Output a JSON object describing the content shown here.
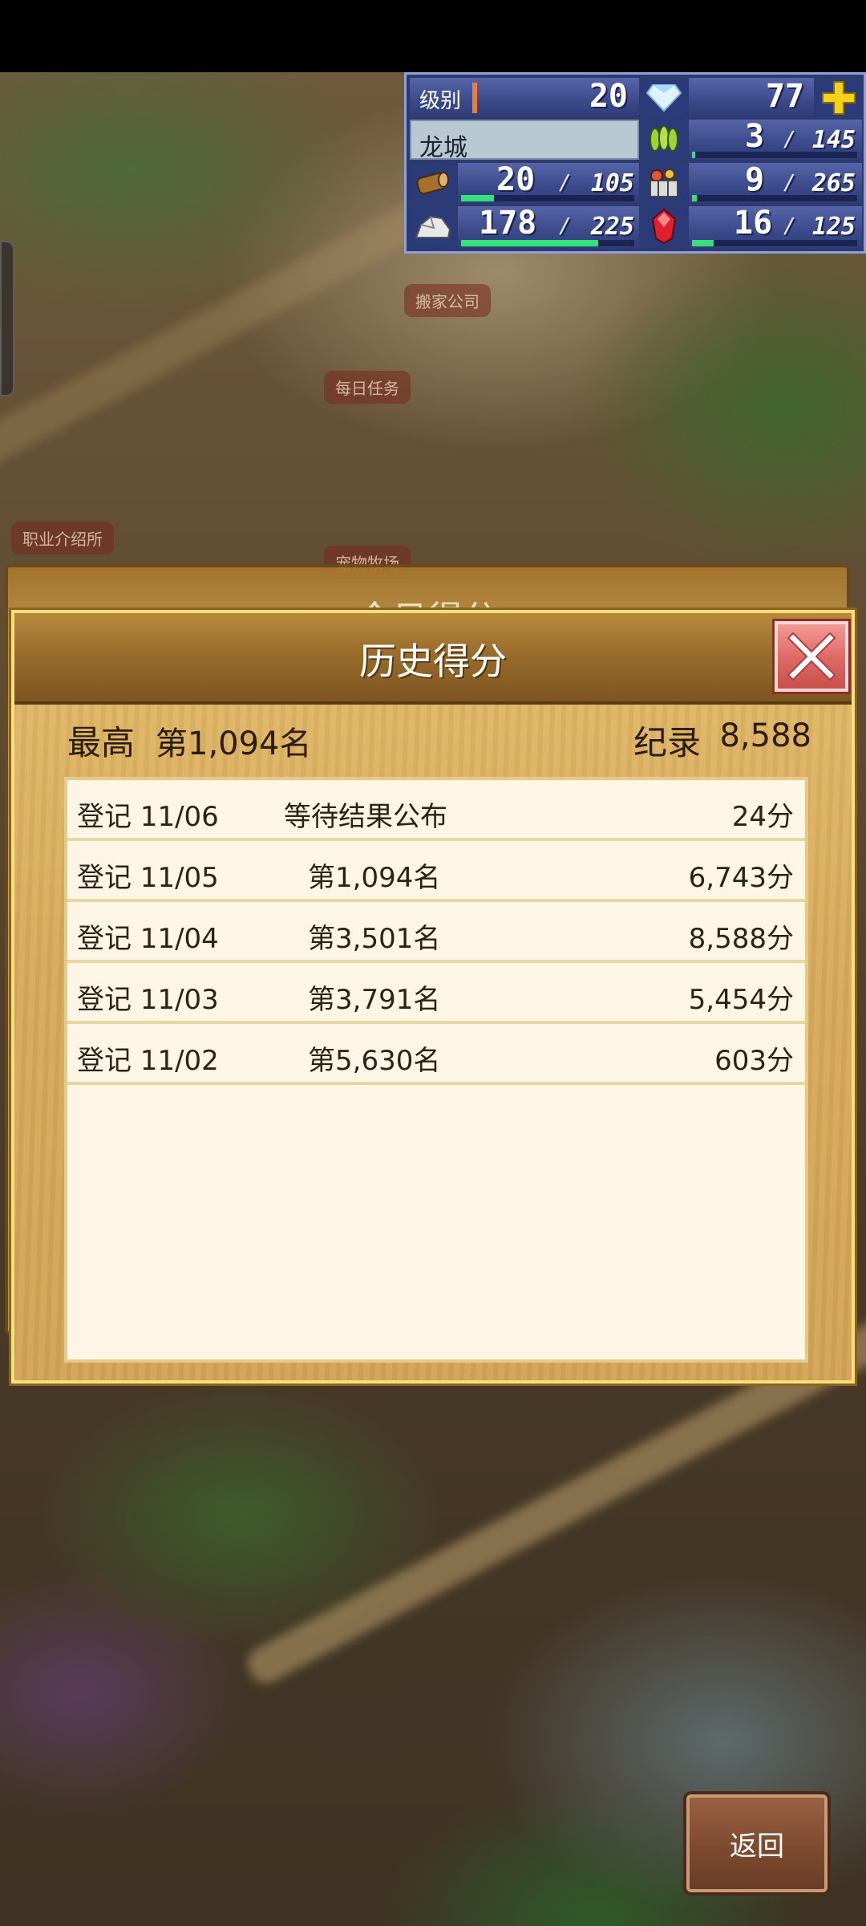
{
  "hud": {
    "level_label": "级别",
    "level_value": "20",
    "gems": "77",
    "town_name": "龙城",
    "grain": {
      "current": "3",
      "max": "145",
      "fill": 0.02
    },
    "wood": {
      "current": "20",
      "max": "105",
      "fill": 0.19
    },
    "food": {
      "current": "9",
      "max": "265",
      "fill": 0.03
    },
    "ore": {
      "current": "178",
      "max": "225",
      "fill": 0.79
    },
    "ruby": {
      "current": "16",
      "max": "125",
      "fill": 0.13
    },
    "slash": "/"
  },
  "map_labels": {
    "moving_company": "搬家公司",
    "daily_tasks": "每日任务",
    "job_agency": "职业介绍所",
    "pet_ranch": "宠物牧场"
  },
  "back_panel": {
    "title": "今日得分"
  },
  "dialog": {
    "title": "历史得分",
    "best_label": "最高",
    "best_rank": "第1,094名",
    "record_label": "纪录",
    "record_value": "8,588",
    "rows": [
      {
        "date": "登记 11/06",
        "status": "等待结果公布",
        "rank": "",
        "score": "24分"
      },
      {
        "date": "登记 11/05",
        "status": "",
        "rank": "第1,094名",
        "score": "6,743分"
      },
      {
        "date": "登记 11/04",
        "status": "",
        "rank": "第3,501名",
        "score": "8,588分"
      },
      {
        "date": "登记 11/03",
        "status": "",
        "rank": "第3,791名",
        "score": "5,454分"
      },
      {
        "date": "登记 11/02",
        "status": "",
        "rank": "第5,630名",
        "score": "603分"
      }
    ]
  },
  "back_button": "返回"
}
